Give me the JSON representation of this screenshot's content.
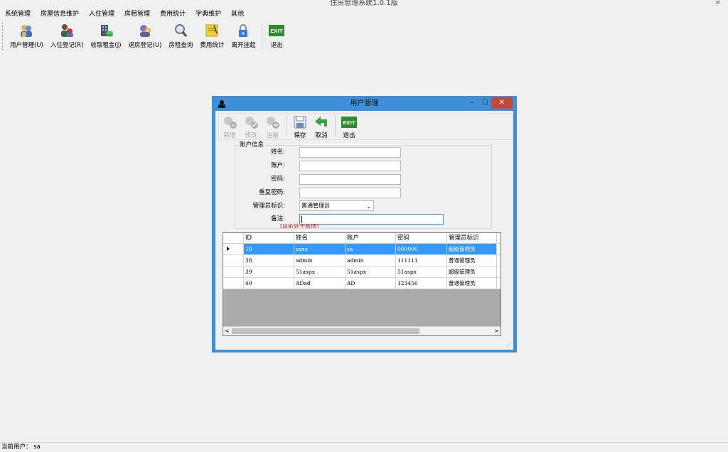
{
  "app": {
    "title": "住房管理系统1.0.1版",
    "close": "✕"
  },
  "menu": [
    "系统管理",
    "房屋信息维护",
    "入住管理",
    "房租管理",
    "费用统计",
    "字典维护",
    "其他"
  ],
  "toolbar": [
    {
      "label": "用户管理(U)",
      "icon": "users-icon"
    },
    {
      "label": "入住登记(R)",
      "icon": "checkin-icon"
    },
    {
      "label": "收取租金(J)",
      "icon": "rent-icon"
    },
    {
      "label": "退房登记(U)",
      "icon": "checkout-icon"
    },
    {
      "label": "房租查询",
      "icon": "search-icon"
    },
    {
      "label": "费用统计",
      "icon": "stats-icon"
    },
    {
      "label": "离开挂起",
      "icon": "lock-icon"
    },
    {
      "label": "退出",
      "icon": "exit-icon"
    }
  ],
  "dialog": {
    "title": "用户管理",
    "toolbar": {
      "add": "新增",
      "edit": "修改",
      "delete": "注销",
      "save": "保存",
      "cancel": "取消",
      "exit": "退出",
      "exit_icon_text": "EXIT"
    },
    "form": {
      "legend": "账户信息",
      "name_label": "姓名:",
      "account_label": "账户:",
      "password_label": "密码:",
      "confirm_label": "重复密码:",
      "role_label": "管理员标识:",
      "role_value": "普通管理员",
      "note_label": "备注:",
      "status_note": "[目前处于新增]"
    },
    "grid": {
      "headers": [
        "ID",
        "姓名",
        "账户",
        "密码",
        "管理员标识"
      ],
      "rows": [
        [
          "19",
          "xxxx",
          "sa",
          "000000",
          "超级管理员"
        ],
        [
          "38",
          "admin",
          "admin",
          "111111",
          "普通管理员"
        ],
        [
          "39",
          "51aspx",
          "51aspx",
          "51aspx",
          "超级管理员"
        ],
        [
          "40",
          "ADad",
          "AD",
          "123456",
          "普通管理员"
        ]
      ]
    }
  },
  "status": {
    "text": "当前用户： sa"
  },
  "colors": {
    "accent": "#3c8fd8",
    "selected_row": "#3399ff",
    "close_button": "#c7473a"
  }
}
